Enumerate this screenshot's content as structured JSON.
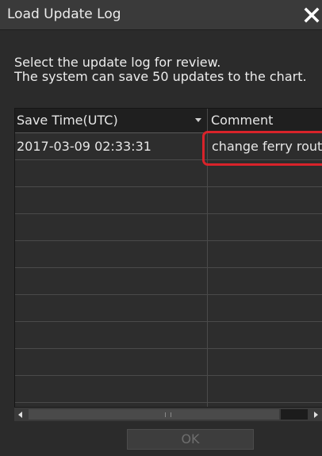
{
  "window": {
    "title": "Load Update Log",
    "close_icon": "close-x-icon"
  },
  "instructions": {
    "line1": "Select the update log for review.",
    "line2": "The system can save 50 updates to the chart."
  },
  "table": {
    "columns": {
      "save_time": "Save Time(UTC)",
      "comment": "Comment"
    },
    "sort_icon": "sort-descending-icon",
    "rows": [
      {
        "save_time": "2017-03-09 02:33:31",
        "comment": "change ferry rout"
      },
      {
        "save_time": "",
        "comment": ""
      },
      {
        "save_time": "",
        "comment": ""
      },
      {
        "save_time": "",
        "comment": ""
      },
      {
        "save_time": "",
        "comment": ""
      },
      {
        "save_time": "",
        "comment": ""
      },
      {
        "save_time": "",
        "comment": ""
      },
      {
        "save_time": "",
        "comment": ""
      },
      {
        "save_time": "",
        "comment": ""
      },
      {
        "save_time": "",
        "comment": ""
      }
    ]
  },
  "scrollbar": {
    "left_icon": "scroll-left-icon",
    "right_icon": "scroll-right-icon"
  },
  "buttons": {
    "ok_label": "OK"
  },
  "colors": {
    "background": "#2b2b2b",
    "highlight": "#d8232a",
    "disabled_text": "#6e6e6e"
  }
}
